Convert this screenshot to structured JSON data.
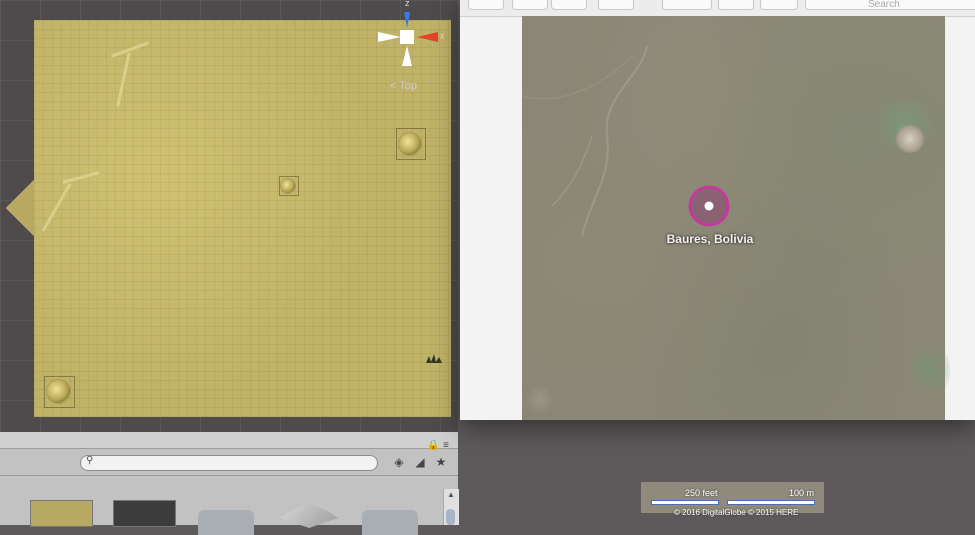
{
  "scene": {
    "gizmo": {
      "axis_z": "z",
      "axis_x": "x",
      "view_label": "Top",
      "view_arrow": "<"
    }
  },
  "project": {
    "search": {
      "value": "",
      "placeholder": ""
    }
  },
  "maps": {
    "search_placeholder": "Search",
    "pin_label": "Baures, Bolivia",
    "scale_feet": "250 feet",
    "scale_meters": "100 m",
    "copyright": "© 2016 DigitalGlobe © 2015 HERE"
  },
  "colors": {
    "terrain": "#c0b266",
    "gizmo_z": "#3b7ae6",
    "gizmo_x": "#e2442c",
    "pin_ring": "#c43a9a",
    "pin_fill": "#8b6174"
  },
  "icons": [
    "search-icon",
    "filter-icon",
    "tag-icon",
    "star-icon",
    "lock-icon",
    "menu-icon"
  ]
}
